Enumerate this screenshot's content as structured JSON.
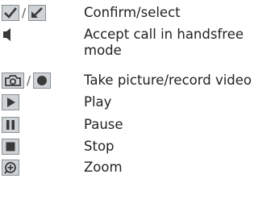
{
  "items": [
    {
      "icons": [
        "checkmark-icon",
        "check-arrow-icon"
      ],
      "separator": "/",
      "label": "Confirm/select"
    },
    {
      "icons": [
        "speaker-icon"
      ],
      "label_lines": [
        "Accept call in handsfree",
        "mode"
      ]
    },
    {
      "icons": [
        "camera-icon",
        "record-icon"
      ],
      "separator": "/",
      "label": "Take picture/record video"
    },
    {
      "icons": [
        "play-icon"
      ],
      "label": "Play"
    },
    {
      "icons": [
        "pause-icon"
      ],
      "label": "Pause"
    },
    {
      "icons": [
        "stop-icon"
      ],
      "label": "Stop"
    },
    {
      "icons": [
        "zoom-icon"
      ],
      "label": "Zoom"
    }
  ],
  "colors": {
    "icon_fill": "#cfd3d6",
    "icon_border": "#8a8f93",
    "glyph": "#3a3a3a",
    "text": "#222222"
  }
}
